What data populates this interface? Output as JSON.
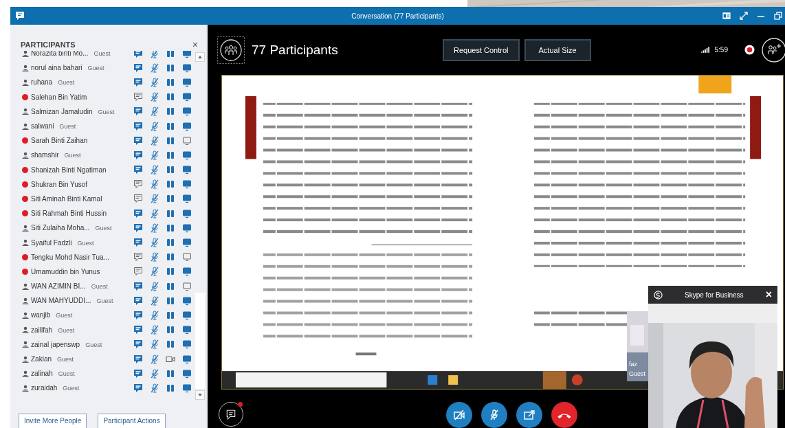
{
  "window": {
    "title": "Conversation (77 Participants)"
  },
  "participants_panel": {
    "heading": "PARTICIPANTS",
    "close": "×",
    "participants": [
      {
        "name": "Norazita binti Mo...",
        "role": "Guest",
        "kind": "guest",
        "chat": true,
        "muted": true,
        "video_paused": true,
        "screen": true
      },
      {
        "name": "norul aina bahari",
        "role": "Guest",
        "kind": "guest",
        "chat": true,
        "muted": true,
        "video_paused": true,
        "screen": true
      },
      {
        "name": "ruhana",
        "role": "Guest",
        "kind": "guest",
        "chat": true,
        "muted": true,
        "video_paused": true,
        "screen": true
      },
      {
        "name": "Salehan Bin Yatim",
        "kind": "user",
        "chat": false,
        "muted": true,
        "video_paused": true,
        "screen": true
      },
      {
        "name": "Salmizan Jamaludin",
        "role": "Guest",
        "kind": "guest",
        "chat": true,
        "muted": true,
        "video_paused": true,
        "screen": true
      },
      {
        "name": "salwani",
        "role": "Guest",
        "kind": "guest",
        "chat": true,
        "muted": true,
        "video_paused": true,
        "screen": true
      },
      {
        "name": "Sarah Binti Zaihan",
        "kind": "user",
        "chat": true,
        "muted": true,
        "video_paused": true,
        "screen": false
      },
      {
        "name": "shamshir",
        "role": "Guest",
        "kind": "guest",
        "chat": true,
        "muted": true,
        "video_paused": true,
        "screen": true
      },
      {
        "name": "Shanizah Binti Ngatiman",
        "kind": "user",
        "chat": true,
        "muted": true,
        "video_paused": true,
        "screen": true
      },
      {
        "name": "Shukran Bin Yusof",
        "kind": "user",
        "chat": false,
        "muted": true,
        "video_paused": true,
        "screen": true
      },
      {
        "name": "Siti Aminah Binti Kamal",
        "kind": "user",
        "chat": false,
        "muted": true,
        "video_paused": true,
        "screen": true
      },
      {
        "name": "Siti Rahmah Binti Hussin",
        "kind": "user",
        "chat": true,
        "muted": true,
        "video_paused": true,
        "screen": true
      },
      {
        "name": "Siti Zulaiha Moha...",
        "role": "Guest",
        "kind": "guest",
        "chat": true,
        "muted": true,
        "video_paused": true,
        "screen": true
      },
      {
        "name": "Syaiful Fadzli",
        "role": "Guest",
        "kind": "guest",
        "chat": true,
        "muted": true,
        "video_paused": true,
        "screen": true
      },
      {
        "name": "Tengku Mohd Nasir Tua...",
        "kind": "user",
        "chat": false,
        "muted": true,
        "video_paused": true,
        "screen": false
      },
      {
        "name": "Umamuddin bin Yunus",
        "kind": "user",
        "chat": false,
        "muted": true,
        "video_paused": true,
        "screen": true
      },
      {
        "name": "WAN AZIMIN BI...",
        "role": "Guest",
        "kind": "guest",
        "chat": true,
        "muted": true,
        "video_paused": true,
        "screen": false
      },
      {
        "name": "WAN MAHYUDDI...",
        "role": "Guest",
        "kind": "guest",
        "chat": true,
        "muted": true,
        "video_paused": true,
        "screen": true
      },
      {
        "name": "wanjib",
        "role": "Guest",
        "kind": "guest",
        "chat": true,
        "muted": true,
        "video_paused": true,
        "screen": true
      },
      {
        "name": "zailifah",
        "role": "Guest",
        "kind": "guest",
        "chat": true,
        "muted": true,
        "video_paused": true,
        "screen": true
      },
      {
        "name": "zainal japenswp",
        "role": "Guest",
        "kind": "guest",
        "chat": true,
        "muted": true,
        "video_paused": true,
        "screen": true
      },
      {
        "name": "Zakian",
        "role": "Guest",
        "kind": "guest",
        "chat": true,
        "muted": true,
        "video_paused": false,
        "screen": true
      },
      {
        "name": "zalinah",
        "role": "Guest",
        "kind": "guest",
        "chat": true,
        "muted": true,
        "video_paused": true,
        "screen": true
      },
      {
        "name": "zuraidah",
        "role": "Guest",
        "kind": "guest",
        "chat": true,
        "muted": true,
        "video_paused": true,
        "screen": true
      }
    ],
    "buttons": [
      "Invite More People",
      "Participant Actions"
    ]
  },
  "stage": {
    "heading": "77 Participants",
    "buttons": [
      "Request Control",
      "Actual Size"
    ],
    "timer": "5:59"
  },
  "guest_tile": {
    "name": "faz",
    "role": "Guest"
  },
  "video_window": {
    "title": "Skype for Business",
    "close": "×"
  },
  "call_controls": {
    "chat_unread": true
  }
}
